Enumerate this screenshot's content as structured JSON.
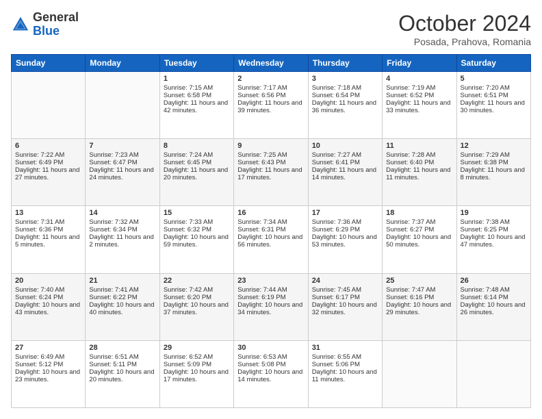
{
  "header": {
    "logo": {
      "line1": "General",
      "line2": "Blue"
    },
    "title": "October 2024",
    "location": "Posada, Prahova, Romania"
  },
  "days_of_week": [
    "Sunday",
    "Monday",
    "Tuesday",
    "Wednesday",
    "Thursday",
    "Friday",
    "Saturday"
  ],
  "weeks": [
    [
      {
        "day": "",
        "content": ""
      },
      {
        "day": "",
        "content": ""
      },
      {
        "day": "1",
        "content": "Sunrise: 7:15 AM\nSunset: 6:58 PM\nDaylight: 11 hours and 42 minutes."
      },
      {
        "day": "2",
        "content": "Sunrise: 7:17 AM\nSunset: 6:56 PM\nDaylight: 11 hours and 39 minutes."
      },
      {
        "day": "3",
        "content": "Sunrise: 7:18 AM\nSunset: 6:54 PM\nDaylight: 11 hours and 36 minutes."
      },
      {
        "day": "4",
        "content": "Sunrise: 7:19 AM\nSunset: 6:52 PM\nDaylight: 11 hours and 33 minutes."
      },
      {
        "day": "5",
        "content": "Sunrise: 7:20 AM\nSunset: 6:51 PM\nDaylight: 11 hours and 30 minutes."
      }
    ],
    [
      {
        "day": "6",
        "content": "Sunrise: 7:22 AM\nSunset: 6:49 PM\nDaylight: 11 hours and 27 minutes."
      },
      {
        "day": "7",
        "content": "Sunrise: 7:23 AM\nSunset: 6:47 PM\nDaylight: 11 hours and 24 minutes."
      },
      {
        "day": "8",
        "content": "Sunrise: 7:24 AM\nSunset: 6:45 PM\nDaylight: 11 hours and 20 minutes."
      },
      {
        "day": "9",
        "content": "Sunrise: 7:25 AM\nSunset: 6:43 PM\nDaylight: 11 hours and 17 minutes."
      },
      {
        "day": "10",
        "content": "Sunrise: 7:27 AM\nSunset: 6:41 PM\nDaylight: 11 hours and 14 minutes."
      },
      {
        "day": "11",
        "content": "Sunrise: 7:28 AM\nSunset: 6:40 PM\nDaylight: 11 hours and 11 minutes."
      },
      {
        "day": "12",
        "content": "Sunrise: 7:29 AM\nSunset: 6:38 PM\nDaylight: 11 hours and 8 minutes."
      }
    ],
    [
      {
        "day": "13",
        "content": "Sunrise: 7:31 AM\nSunset: 6:36 PM\nDaylight: 11 hours and 5 minutes."
      },
      {
        "day": "14",
        "content": "Sunrise: 7:32 AM\nSunset: 6:34 PM\nDaylight: 11 hours and 2 minutes."
      },
      {
        "day": "15",
        "content": "Sunrise: 7:33 AM\nSunset: 6:32 PM\nDaylight: 10 hours and 59 minutes."
      },
      {
        "day": "16",
        "content": "Sunrise: 7:34 AM\nSunset: 6:31 PM\nDaylight: 10 hours and 56 minutes."
      },
      {
        "day": "17",
        "content": "Sunrise: 7:36 AM\nSunset: 6:29 PM\nDaylight: 10 hours and 53 minutes."
      },
      {
        "day": "18",
        "content": "Sunrise: 7:37 AM\nSunset: 6:27 PM\nDaylight: 10 hours and 50 minutes."
      },
      {
        "day": "19",
        "content": "Sunrise: 7:38 AM\nSunset: 6:25 PM\nDaylight: 10 hours and 47 minutes."
      }
    ],
    [
      {
        "day": "20",
        "content": "Sunrise: 7:40 AM\nSunset: 6:24 PM\nDaylight: 10 hours and 43 minutes."
      },
      {
        "day": "21",
        "content": "Sunrise: 7:41 AM\nSunset: 6:22 PM\nDaylight: 10 hours and 40 minutes."
      },
      {
        "day": "22",
        "content": "Sunrise: 7:42 AM\nSunset: 6:20 PM\nDaylight: 10 hours and 37 minutes."
      },
      {
        "day": "23",
        "content": "Sunrise: 7:44 AM\nSunset: 6:19 PM\nDaylight: 10 hours and 34 minutes."
      },
      {
        "day": "24",
        "content": "Sunrise: 7:45 AM\nSunset: 6:17 PM\nDaylight: 10 hours and 32 minutes."
      },
      {
        "day": "25",
        "content": "Sunrise: 7:47 AM\nSunset: 6:16 PM\nDaylight: 10 hours and 29 minutes."
      },
      {
        "day": "26",
        "content": "Sunrise: 7:48 AM\nSunset: 6:14 PM\nDaylight: 10 hours and 26 minutes."
      }
    ],
    [
      {
        "day": "27",
        "content": "Sunrise: 6:49 AM\nSunset: 5:12 PM\nDaylight: 10 hours and 23 minutes."
      },
      {
        "day": "28",
        "content": "Sunrise: 6:51 AM\nSunset: 5:11 PM\nDaylight: 10 hours and 20 minutes."
      },
      {
        "day": "29",
        "content": "Sunrise: 6:52 AM\nSunset: 5:09 PM\nDaylight: 10 hours and 17 minutes."
      },
      {
        "day": "30",
        "content": "Sunrise: 6:53 AM\nSunset: 5:08 PM\nDaylight: 10 hours and 14 minutes."
      },
      {
        "day": "31",
        "content": "Sunrise: 6:55 AM\nSunset: 5:06 PM\nDaylight: 10 hours and 11 minutes."
      },
      {
        "day": "",
        "content": ""
      },
      {
        "day": "",
        "content": ""
      }
    ]
  ]
}
